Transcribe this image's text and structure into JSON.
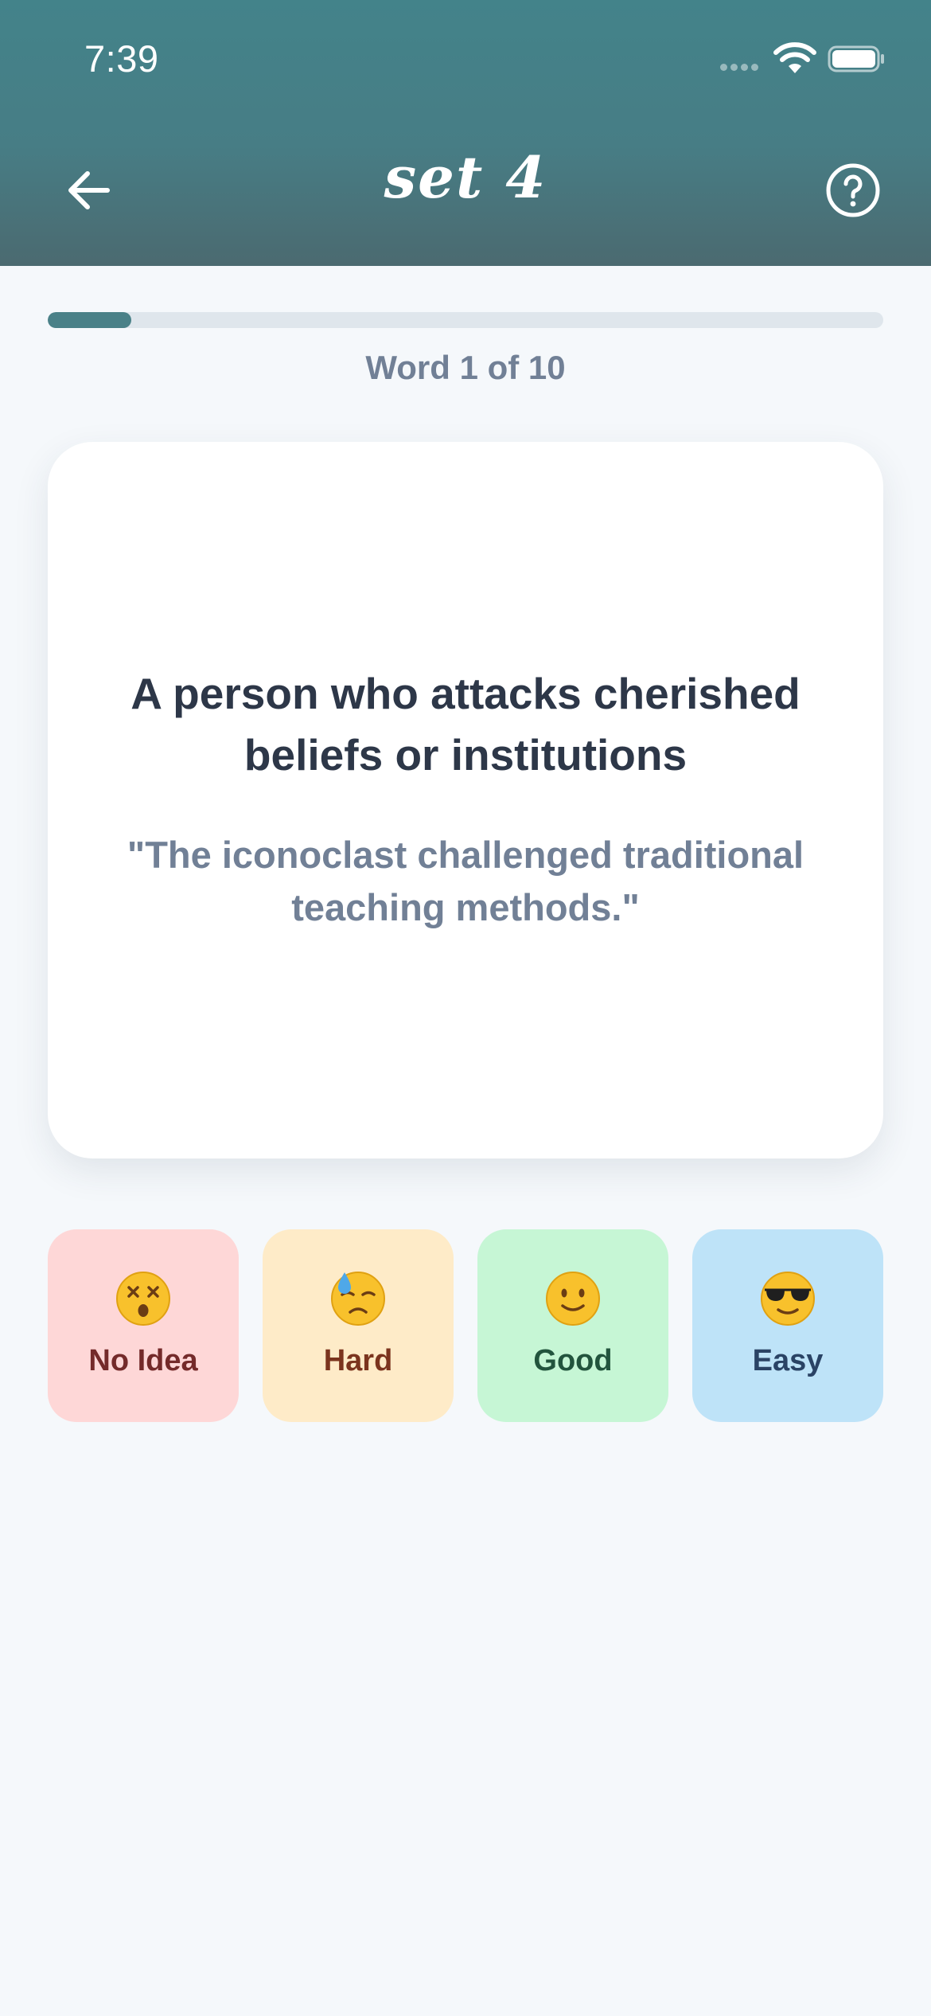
{
  "status_bar": {
    "time": "7:39"
  },
  "header": {
    "title": "set 4",
    "back_icon": "arrow-left-icon",
    "help_icon": "question-circle-icon"
  },
  "progress": {
    "current": 1,
    "total": 10,
    "fraction": 0.1,
    "label": "Word 1 of 10"
  },
  "card": {
    "definition": "A person who attacks cherished beliefs or institutions",
    "example": "\"The iconoclast challenged traditional teaching methods.\""
  },
  "ratings": [
    {
      "label": "No Idea",
      "icon": "dizzy-face-icon",
      "bg": "#fed7d7",
      "fg": "#742a2a"
    },
    {
      "label": "Hard",
      "icon": "downcast-sweat-face-icon",
      "bg": "#feebc8",
      "fg": "#7b341e"
    },
    {
      "label": "Good",
      "icon": "slightly-smiling-face-icon",
      "bg": "#c6f6d5",
      "fg": "#22543d"
    },
    {
      "label": "Easy",
      "icon": "sunglasses-face-icon",
      "bg": "#bee3f8",
      "fg": "#2a4365"
    }
  ],
  "colors": {
    "header": "#43838a",
    "accent": "#4a8188",
    "background": "#f5f8fb"
  }
}
